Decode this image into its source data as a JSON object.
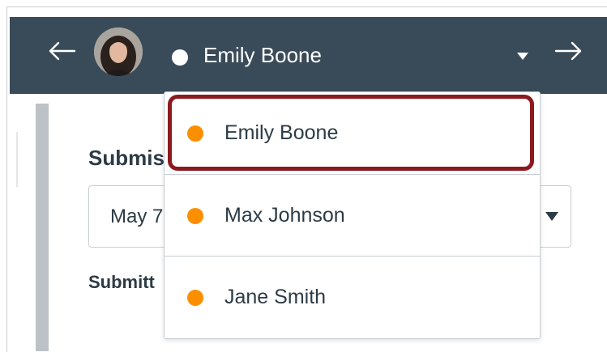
{
  "header": {
    "current_student": "Emily Boone",
    "prev_icon": "arrow-left-icon",
    "next_icon": "arrow-right-icon",
    "dropdown_icon": "caret-down-icon",
    "status_color": "#ffffff"
  },
  "background": {
    "heading_partial": "Submis",
    "date_partial": "May 7",
    "submitted_partial": "Submitt"
  },
  "student_dropdown": {
    "items": [
      {
        "label": "Emily Boone",
        "status_color": "#fc8f00",
        "highlighted": true
      },
      {
        "label": "Max Johnson",
        "status_color": "#fc8f00"
      },
      {
        "label": "Jane Smith",
        "status_color": "#fc8f00"
      }
    ],
    "highlight_color": "#8b1a1f"
  },
  "colors": {
    "header_bg": "#394b58",
    "text": "#2d3b45",
    "border": "#c7cdd1"
  }
}
